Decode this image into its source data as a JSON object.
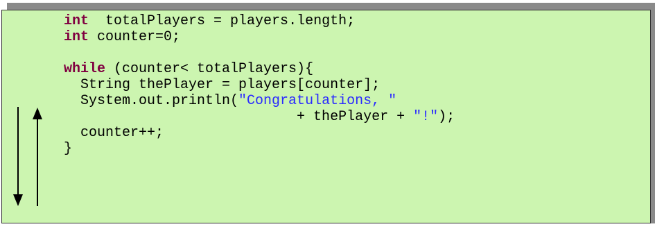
{
  "code": {
    "line1": {
      "kw": "int",
      "text": "  totalPlayers = players.length;"
    },
    "line2": {
      "kw": "int",
      "text": " counter=0;"
    },
    "line3": "",
    "line4": {
      "kw": "while",
      "text": " (counter< totalPlayers){"
    },
    "line5": "  String thePlayer = players[counter];",
    "line6": {
      "text": "  System.out.println(",
      "str": "\"Congratulations, \""
    },
    "line7": {
      "text": "                            + thePlayer + ",
      "str": "\"!\"",
      "end": ");"
    },
    "line8": "  counter++;",
    "line9": "}"
  },
  "colors": {
    "background": "#ccf5b0",
    "keyword": "#800040",
    "string": "#2a2aff",
    "shadow": "#8a8a8a"
  },
  "arrows": {
    "down": "arrow-down-icon",
    "up": "arrow-up-icon"
  }
}
